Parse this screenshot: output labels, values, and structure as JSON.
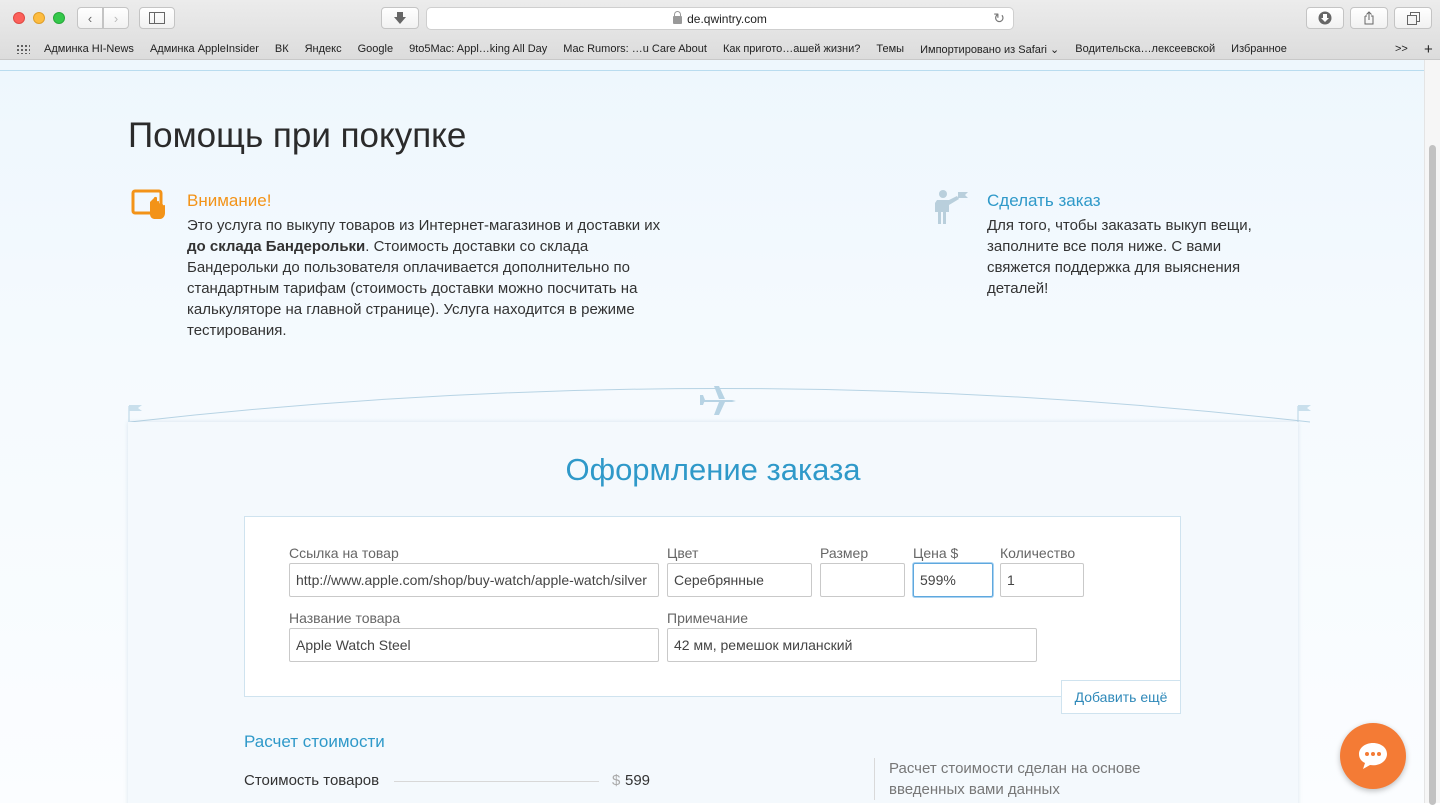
{
  "browser": {
    "url": "de.qwintry.com",
    "bookmarks": [
      "Админка HI-News",
      "Админка AppleInsider",
      "ВК",
      "Яндекс",
      "Google",
      "9to5Mac: Appl…king All Day",
      "Mac Rumors: …u Care About",
      "Как пригото…ашей жизни?",
      "Темы",
      "Импортировано из Safari ⌄",
      "Водительска…лексеевской",
      "Избранное"
    ],
    "overflow": ">>",
    "add": "+"
  },
  "page": {
    "title": "Помощь при покупке",
    "warning": {
      "title": "Внимание!",
      "text1": "Это услуга по выкупу товаров из Интернет-магазинов и доставки их ",
      "bold": "до склада Бандерольки",
      "text2": ". Стоимость доставки со склада Бандерольки до пользователя оплачивается дополнительно по стандартным тарифам (стоимость доставки можно посчитать на калькуляторе на главной странице). Услуга находится в режиме тестирования."
    },
    "order": {
      "title": "Сделать заказ",
      "text": "Для того, чтобы заказать выкуп вещи, заполните все поля ниже. С вами свяжется поддержка для выяснения деталей!"
    }
  },
  "form": {
    "title": "Оформление заказа",
    "labels": {
      "link": "Ссылка на товар",
      "color": "Цвет",
      "size": "Размер",
      "price": "Цена $",
      "qty": "Количество",
      "name": "Название товара",
      "note": "Примечание"
    },
    "values": {
      "link": "http://www.apple.com/shop/buy-watch/apple-watch/silver",
      "color": "Серебрянные",
      "size": "",
      "price": "599%",
      "qty": "1",
      "name": "Apple Watch Steel",
      "note": "42 мм, ремешок миланский"
    },
    "add_more": "Добавить ещё"
  },
  "calc": {
    "title": "Расчет стоимости",
    "goods_label": "Стоимость товаров",
    "currency": "$",
    "goods_value": "599",
    "side_text": "Расчет стоимости сделан на основе введенных вами данных"
  }
}
